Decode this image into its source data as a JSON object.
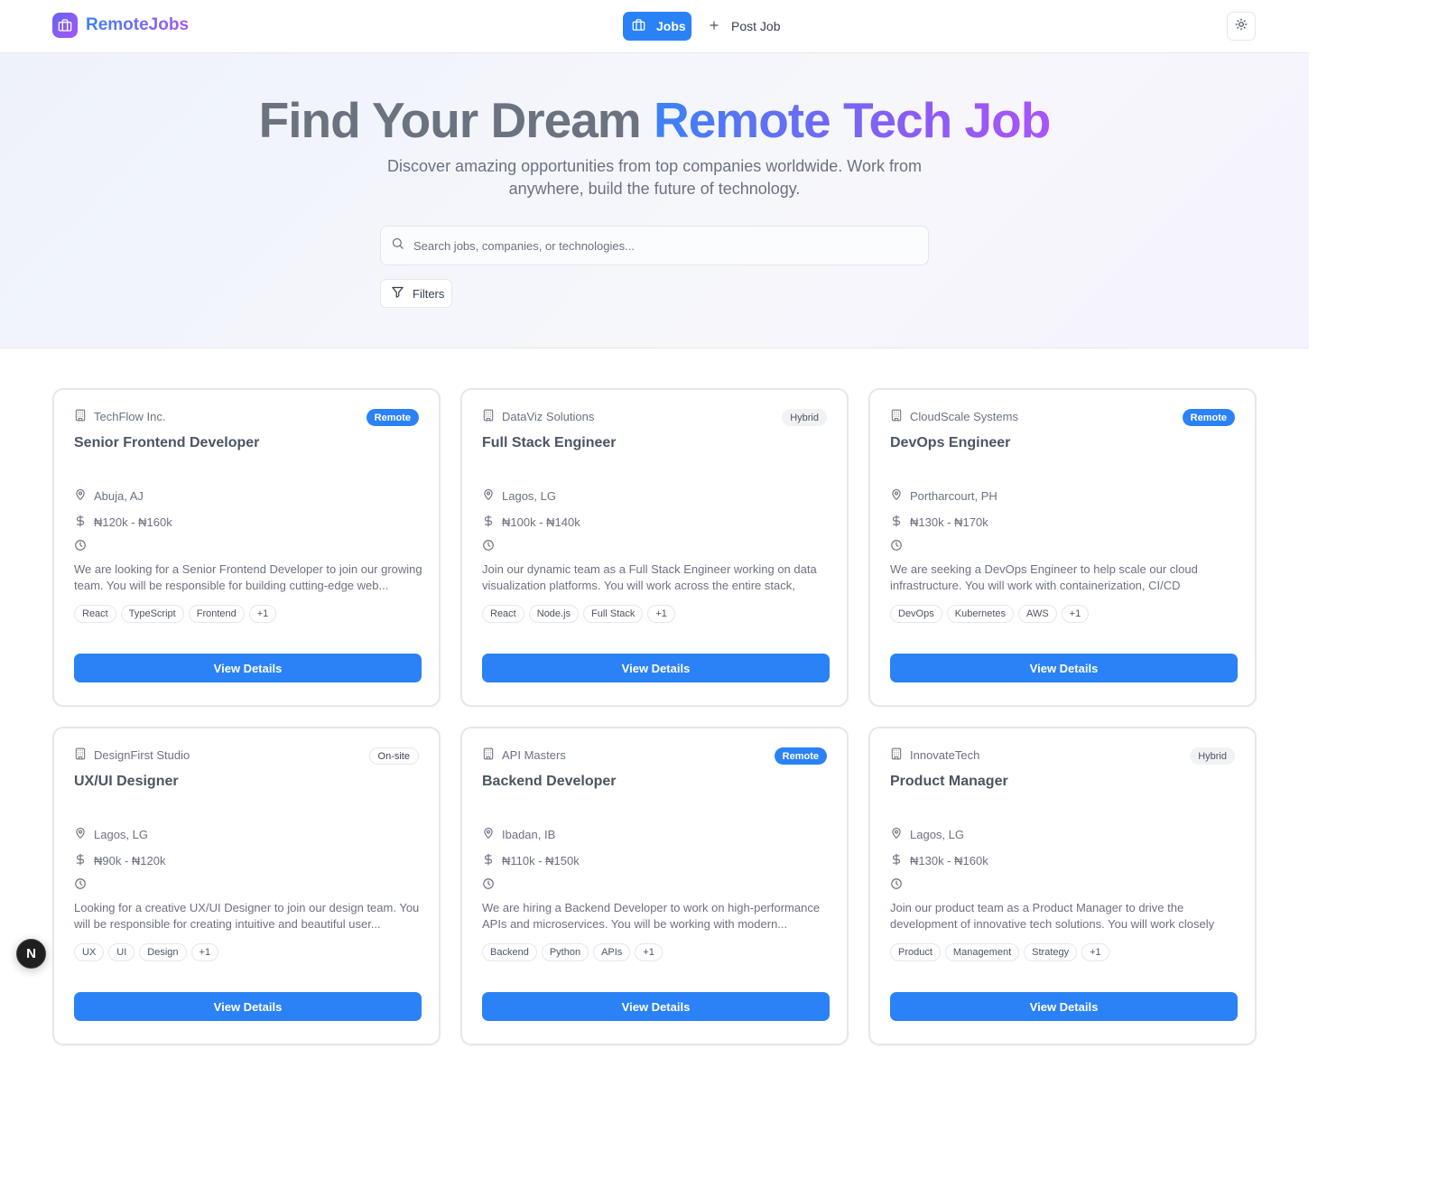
{
  "header": {
    "brand": "RemoteJobs",
    "nav": {
      "jobs_label": "Jobs",
      "post_label": "Post Job"
    }
  },
  "hero": {
    "title_plain": "Find Your Dream ",
    "title_highlight": "Remote Tech Job",
    "subtitle": "Discover amazing opportunities from top companies worldwide. Work from anywhere, build the future of technology.",
    "search_placeholder": "Search jobs, companies, or technologies...",
    "filters_label": "Filters"
  },
  "colors": {
    "accent": "#2b82f6",
    "gradient_start": "#3b82f6",
    "gradient_end": "#a855f7"
  },
  "jobs": [
    {
      "company": "TechFlow Inc.",
      "type": "Remote",
      "type_style": "remote",
      "title": "Senior Frontend Developer",
      "location": "Abuja, AJ",
      "salary": "₦120k - ₦160k",
      "description": "We are looking for a Senior Frontend Developer to join our growing team. You will be responsible for building cutting-edge web...",
      "tags": [
        "React",
        "TypeScript",
        "Frontend",
        "+1"
      ],
      "button": "View Details"
    },
    {
      "company": "DataViz Solutions",
      "type": "Hybrid",
      "type_style": "hybrid",
      "title": "Full Stack Engineer",
      "location": "Lagos, LG",
      "salary": "₦100k - ₦140k",
      "description": "Join our dynamic team as a Full Stack Engineer working on data visualization platforms. You will work across the entire stack, from...",
      "tags": [
        "React",
        "Node.js",
        "Full Stack",
        "+1"
      ],
      "button": "View Details"
    },
    {
      "company": "CloudScale Systems",
      "type": "Remote",
      "type_style": "remote",
      "title": "DevOps Engineer",
      "location": "Portharcourt, PH",
      "salary": "₦130k - ₦170k",
      "description": "We are seeking a DevOps Engineer to help scale our cloud infrastructure. You will work with containerization, CI/CD pipelines,...",
      "tags": [
        "DevOps",
        "Kubernetes",
        "AWS",
        "+1"
      ],
      "button": "View Details"
    },
    {
      "company": "DesignFirst Studio",
      "type": "On-site",
      "type_style": "onsite",
      "title": "UX/UI Designer",
      "location": "Lagos, LG",
      "salary": "₦90k - ₦120k",
      "description": "Looking for a creative UX/UI Designer to join our design team. You will be responsible for creating intuitive and beautiful user...",
      "tags": [
        "UX",
        "UI",
        "Design",
        "+1"
      ],
      "button": "View Details"
    },
    {
      "company": "API Masters",
      "type": "Remote",
      "type_style": "remote",
      "title": "Backend Developer",
      "location": "Ibadan, IB",
      "salary": "₦110k - ₦150k",
      "description": "We are hiring a Backend Developer to work on high-performance APIs and microservices. You will be working with modern...",
      "tags": [
        "Backend",
        "Python",
        "APIs",
        "+1"
      ],
      "button": "View Details"
    },
    {
      "company": "InnovateTech",
      "type": "Hybrid",
      "type_style": "hybrid",
      "title": "Product Manager",
      "location": "Lagos, LG",
      "salary": "₦130k - ₦160k",
      "description": "Join our product team as a Product Manager to drive the development of innovative tech solutions. You will work closely wit...",
      "tags": [
        "Product",
        "Management",
        "Strategy",
        "+1"
      ],
      "button": "View Details"
    }
  ],
  "floating_badge": "N"
}
